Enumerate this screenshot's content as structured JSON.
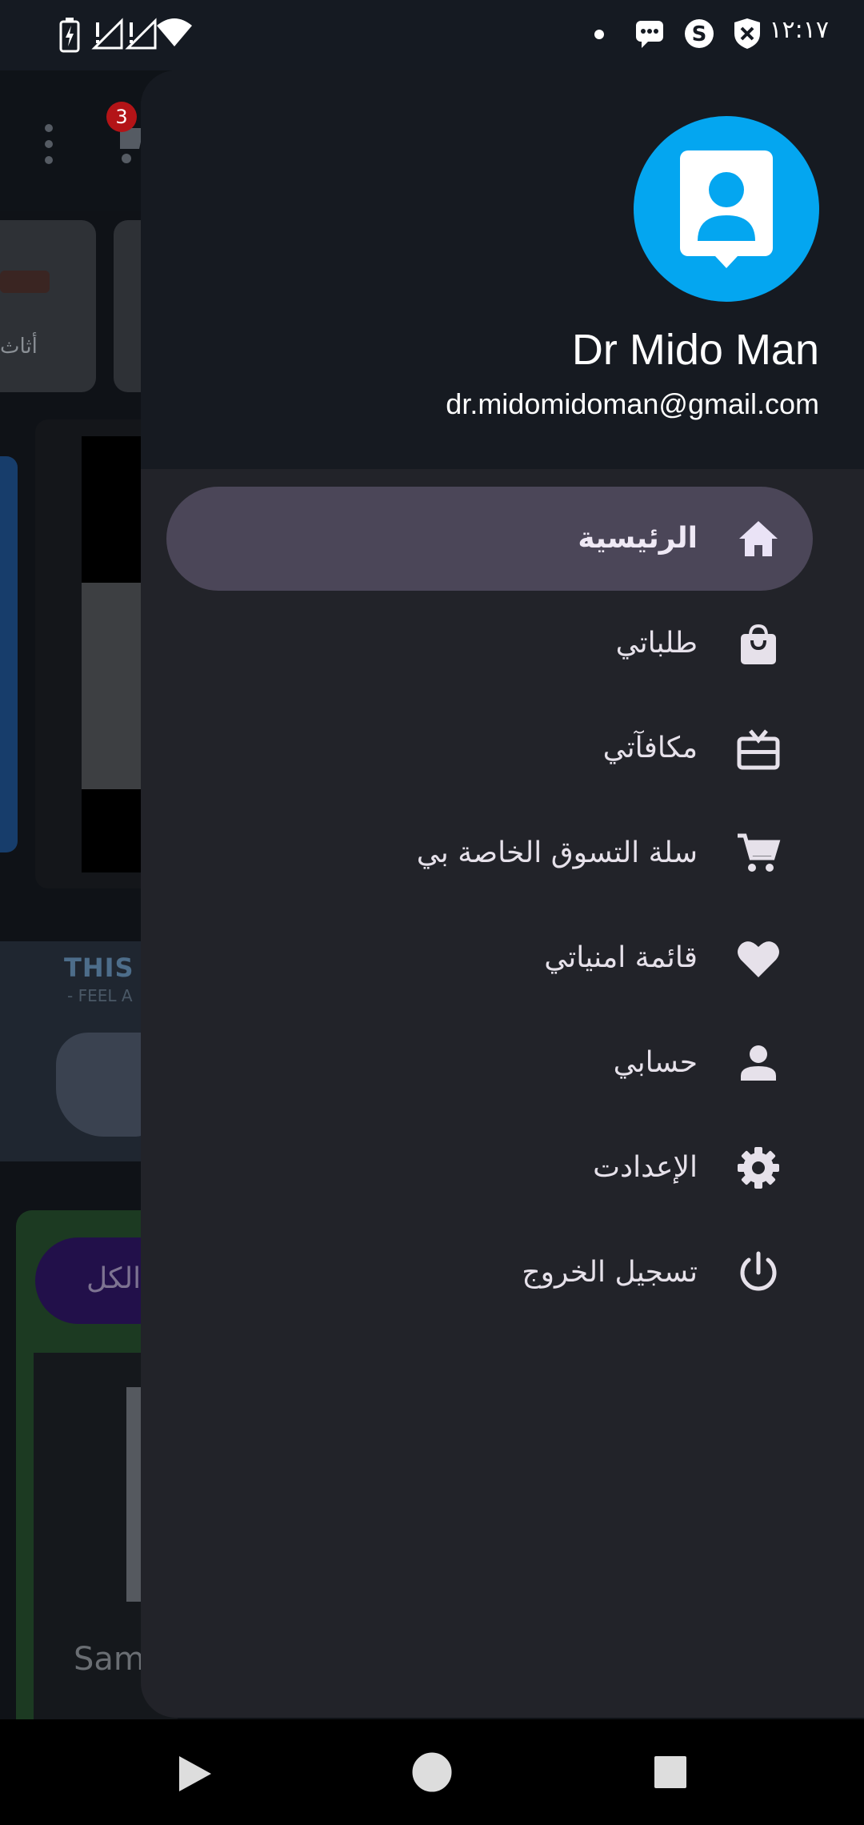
{
  "status_bar": {
    "time": "١٢:١٧",
    "icons": [
      "battery-charging-icon",
      "signal-no-data-icon",
      "signal-no-data-icon",
      "wifi-icon",
      "dot-icon",
      "messages-icon",
      "s-app-icon",
      "shield-x-icon"
    ]
  },
  "background_app": {
    "cart_badge": "3",
    "category_label": "أثاث",
    "promo_title": "THIS I",
    "promo_subtitle": "- FEEL A",
    "view_all_label": "الكل",
    "product_label": "Sam"
  },
  "drawer": {
    "user_name": "Dr Mido Man",
    "user_email": "dr.midomidoman@gmail.com",
    "menu": [
      {
        "label": "الرئيسية",
        "icon": "home-icon",
        "active": true
      },
      {
        "label": "طلباتي",
        "icon": "shopping-bag-icon",
        "active": false
      },
      {
        "label": "مكافآتي",
        "icon": "rewards-icon",
        "active": false
      },
      {
        "label": "سلة التسوق الخاصة بي",
        "icon": "cart-icon",
        "active": false
      },
      {
        "label": "قائمة امنياتي",
        "icon": "heart-icon",
        "active": false
      },
      {
        "label": "حسابي",
        "icon": "person-icon",
        "active": false
      },
      {
        "label": "الإعدادت",
        "icon": "gear-icon",
        "active": false
      },
      {
        "label": "تسجيل الخروج",
        "icon": "power-icon",
        "active": false
      }
    ]
  },
  "nav_bar": {
    "buttons": [
      "back-icon",
      "home-circle-icon",
      "recents-icon"
    ]
  },
  "colors": {
    "accent_avatar": "#04a6f0",
    "active_item": "#4b4658",
    "drawer_bg": "#222329",
    "header_bg": "#161a21"
  }
}
